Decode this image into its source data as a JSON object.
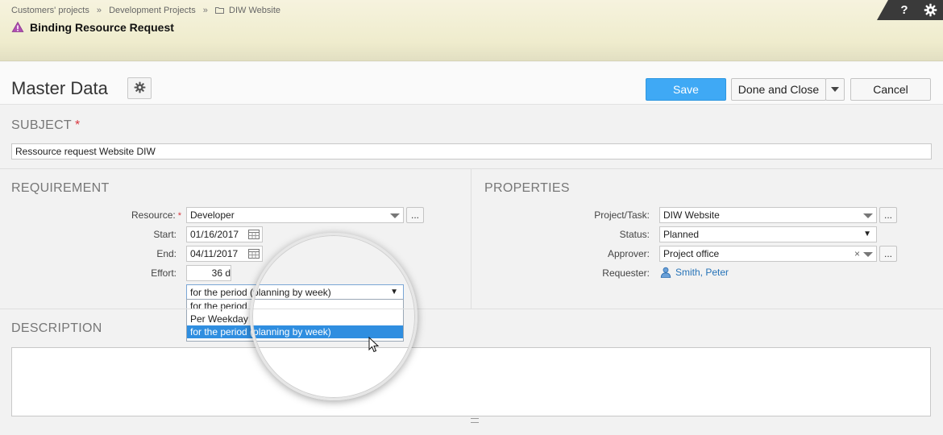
{
  "breadcrumb": [
    "Customers' projects",
    "Development Projects",
    "DIW Website"
  ],
  "breadcrumb_sep": "»",
  "page_title": "Binding Resource Request",
  "top_actions": {
    "help_label": "?"
  },
  "master": {
    "title": "Master Data",
    "save_label": "Save",
    "done_close_label": "Done and Close",
    "cancel_label": "Cancel"
  },
  "subject": {
    "title": "SUBJECT",
    "required_mark": "*",
    "value": "Ressource request Website DIW"
  },
  "requirement": {
    "title": "REQUIREMENT",
    "resource_label": "Resource:",
    "resource_required": "*",
    "resource_value": "Developer",
    "start_label": "Start:",
    "start_value": "01/16/2017",
    "end_label": "End:",
    "end_value": "04/11/2017",
    "effort_label": "Effort:",
    "effort_value": "36 d",
    "distribution_value": "for the period (planning by week)",
    "distribution_arrow": "▼",
    "distribution_options": [
      "for the period",
      "Per Weekday",
      "for the period (planning by week)"
    ],
    "ellipsis": "..."
  },
  "properties": {
    "title": "PROPERTIES",
    "project_label": "Project/Task:",
    "project_value": "DIW Website",
    "status_label": "Status:",
    "status_value": "Planned",
    "status_arrow": "▼",
    "approver_label": "Approver:",
    "approver_value": "Project office",
    "approver_clear": "×",
    "requester_label": "Requester:",
    "requester_value": "Smith, Peter",
    "ellipsis": "..."
  },
  "description": {
    "title": "DESCRIPTION"
  },
  "colors": {
    "accent": "#3fa9f5",
    "required": "#d9363e",
    "link": "#2673b8",
    "header_bg": "#efeccd",
    "selected_option": "#2f8ee0"
  },
  "icons": [
    "folder-icon",
    "warning-icon",
    "help-icon",
    "gear-icon",
    "calendar-icon",
    "user-icon",
    "cursor-icon"
  ]
}
